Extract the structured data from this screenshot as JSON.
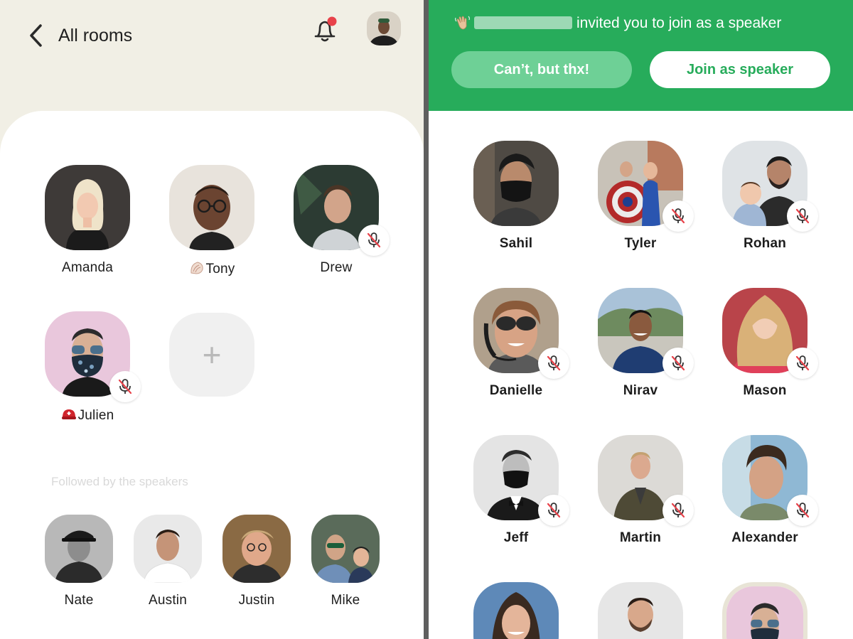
{
  "left": {
    "header": {
      "title": "All rooms"
    },
    "speakers": [
      {
        "name": "Amanda",
        "muted": false
      },
      {
        "name": "Tony",
        "muted": false
      },
      {
        "name": "Drew",
        "muted": true
      },
      {
        "name": "Julien",
        "muted": true
      }
    ],
    "add_label": "+",
    "section_title": "Followed by the speakers",
    "followed": [
      {
        "name": "Nate"
      },
      {
        "name": "Austin"
      },
      {
        "name": "Justin"
      },
      {
        "name": "Mike"
      }
    ]
  },
  "right": {
    "banner": {
      "message": "invited you to join as a speaker",
      "decline_label": "Can’t, but thx!",
      "join_label": "Join as speaker"
    },
    "people": [
      {
        "name": "Sahil",
        "muted": false
      },
      {
        "name": "Tyler",
        "muted": true
      },
      {
        "name": "Rohan",
        "muted": true
      },
      {
        "name": "Danielle",
        "muted": true
      },
      {
        "name": "Nirav",
        "muted": true
      },
      {
        "name": "Mason",
        "muted": true
      },
      {
        "name": "Jeff",
        "muted": true
      },
      {
        "name": "Martin",
        "muted": true
      },
      {
        "name": "Alexander",
        "muted": true
      }
    ]
  },
  "colors": {
    "accent_green": "#27ac5b",
    "light_green": "#6ed096",
    "notification_dot": "#e8424a",
    "mute_slash": "#e8424a"
  }
}
